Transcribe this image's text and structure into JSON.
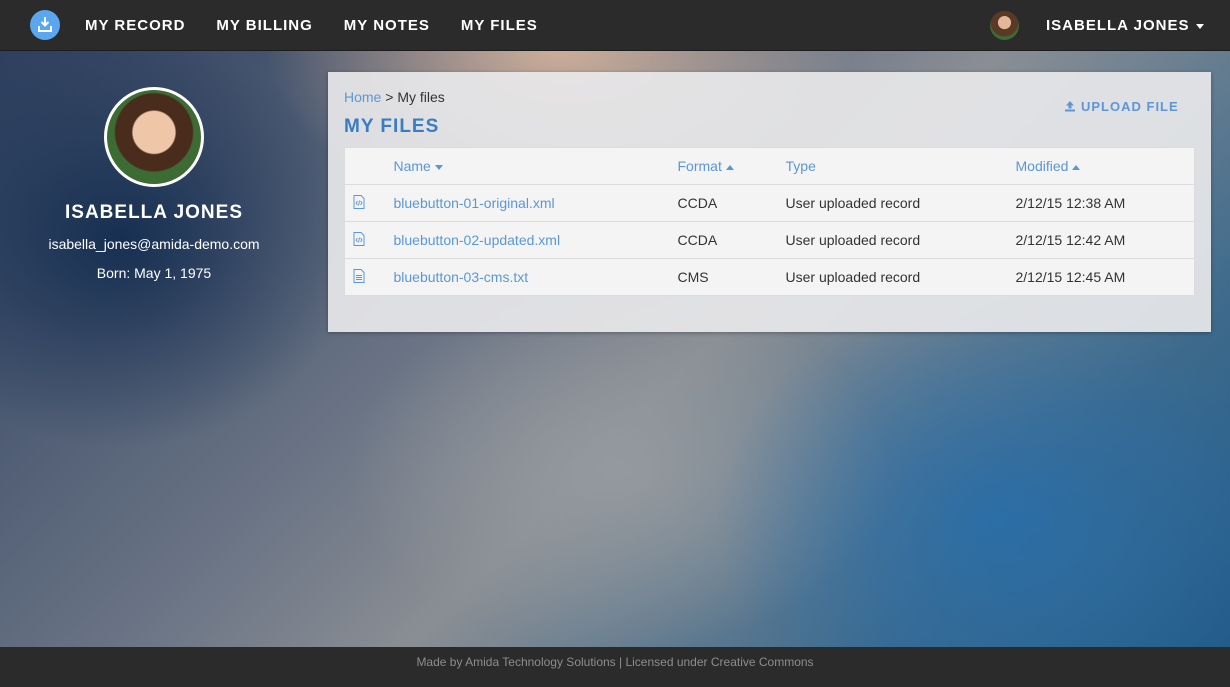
{
  "nav": {
    "links": [
      "MY RECORD",
      "MY BILLING",
      "MY NOTES",
      "MY FILES"
    ],
    "user_name": "ISABELLA JONES"
  },
  "profile": {
    "name": "ISABELLA JONES",
    "email": "isabella_jones@amida-demo.com",
    "born": "Born: May 1, 1975"
  },
  "panel": {
    "breadcrumb_home": "Home",
    "breadcrumb_separator": ">",
    "breadcrumb_current": "My files",
    "title": "MY FILES",
    "upload_label": "UPLOAD FILE"
  },
  "table": {
    "headers": {
      "name": "Name",
      "format": "Format",
      "type": "Type",
      "modified": "Modified"
    },
    "rows": [
      {
        "icon": "xml-file-icon",
        "name": "bluebutton-01-original.xml",
        "format": "CCDA",
        "type": "User uploaded record",
        "modified": "2/12/15 12:38 AM"
      },
      {
        "icon": "xml-file-icon",
        "name": "bluebutton-02-updated.xml",
        "format": "CCDA",
        "type": "User uploaded record",
        "modified": "2/12/15 12:42 AM"
      },
      {
        "icon": "text-file-icon",
        "name": "bluebutton-03-cms.txt",
        "format": "CMS",
        "type": "User uploaded record",
        "modified": "2/12/15 12:45 AM"
      }
    ]
  },
  "footer": {
    "text": "Made by Amida Technology Solutions | Licensed under Creative Commons"
  },
  "colors": {
    "accent": "#5b97d6",
    "title": "#3a7cc4",
    "navbar": "#2b2b2b"
  }
}
